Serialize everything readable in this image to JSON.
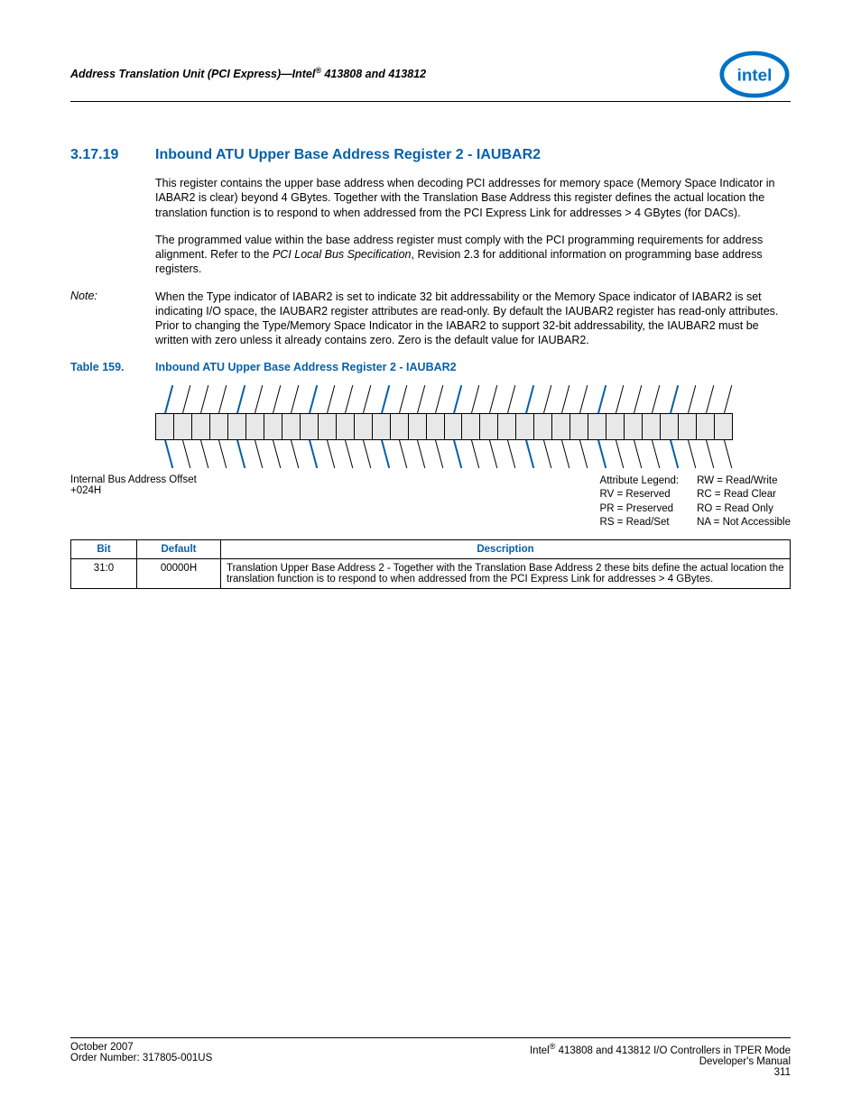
{
  "header": {
    "title_prefix": "Address Translation Unit (PCI Express)—Intel",
    "sup": "®",
    "title_suffix": " 413808 and 413812"
  },
  "section": {
    "number": "3.17.19",
    "title": "Inbound ATU Upper Base Address Register 2 - IAUBAR2"
  },
  "para1": "This register contains the upper base address when decoding PCI addresses for memory space (Memory Space Indicator in IABAR2 is clear) beyond 4 GBytes. Together with the Translation Base Address this register defines the actual location the translation function is to respond to when addressed from the PCI Express Link for addresses > 4 GBytes (for DACs).",
  "para2_a": "The programmed value within the base address register must comply with the PCI programming requirements for address alignment. Refer to the ",
  "para2_i": "PCI Local Bus Specification",
  "para2_b": ", Revision 2.3 for additional information on programming base address registers.",
  "note": {
    "label": "Note:",
    "text": "When the Type indicator of IABAR2 is set to indicate 32 bit addressability or the Memory Space indicator of IABAR2 is set indicating I/O space, the IAUBAR2 register attributes are read-only. By default the IAUBAR2 register has read-only attributes. Prior to changing the Type/Memory Space Indicator in the IABAR2 to support 32-bit addressability, the IAUBAR2 must be written with zero unless it already contains zero. Zero is the default value for IAUBAR2."
  },
  "table_label": {
    "num": "Table 159.",
    "title": "Inbound ATU Upper Base Address Register 2 - IAUBAR2"
  },
  "offset": {
    "line1": "Internal Bus Address Offset",
    "line2": "+024H"
  },
  "legend": {
    "title": "Attribute Legend:",
    "rv": "RV = Reserved",
    "pr": "PR = Preserved",
    "rs": "RS = Read/Set",
    "rw": "RW = Read/Write",
    "rc": "RC = Read Clear",
    "ro": "RO = Read Only",
    "na": "NA = Not Accessible"
  },
  "tbl": {
    "h_bit": "Bit",
    "h_def": "Default",
    "h_desc": "Description",
    "r1_bit": "31:0",
    "r1_def": "00000H",
    "r1_desc": "Translation Upper Base Address 2 - Together with the Translation Base Address 2 these bits define the actual location the translation function is to respond to when addressed from the PCI Express Link for addresses > 4 GBytes."
  },
  "footer": {
    "left1": "October 2007",
    "left2": "Order Number: 317805-001US",
    "right1a": "Intel",
    "right1b": " 413808 and 413812 I/O Controllers in TPER Mode",
    "right2": "Developer's Manual",
    "right3": "311"
  }
}
